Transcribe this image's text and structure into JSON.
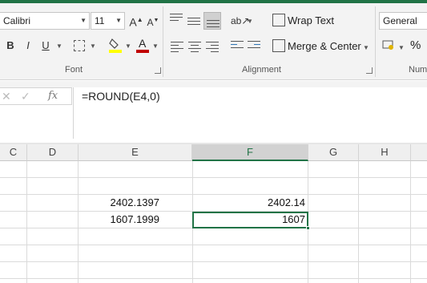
{
  "ribbon": {
    "font_group": {
      "label": "Font",
      "font_name": "Calibri",
      "font_size": "11",
      "grow_label": "A",
      "shrink_label": "A",
      "bold": "B",
      "italic": "I",
      "underline": "U",
      "font_color_label": "A"
    },
    "alignment_group": {
      "label": "Alignment",
      "wrap_text": "Wrap Text",
      "merge_center": "Merge & Center"
    },
    "number_group": {
      "label": "Num",
      "format": "General",
      "percent": "%"
    },
    "colors": {
      "accent": "#217346",
      "fill_yellow": "#ffff00",
      "font_red": "#c00000"
    }
  },
  "formula_bar": {
    "fx": "fx",
    "formula": "=ROUND(E4,0)"
  },
  "grid": {
    "columns": [
      "C",
      "D",
      "E",
      "F",
      "G",
      "H"
    ],
    "selected_column": "F",
    "rows": [
      {
        "E": "2402.1397",
        "F": "2402.14"
      },
      {
        "E": "1607.1999",
        "F": "1607"
      }
    ]
  }
}
